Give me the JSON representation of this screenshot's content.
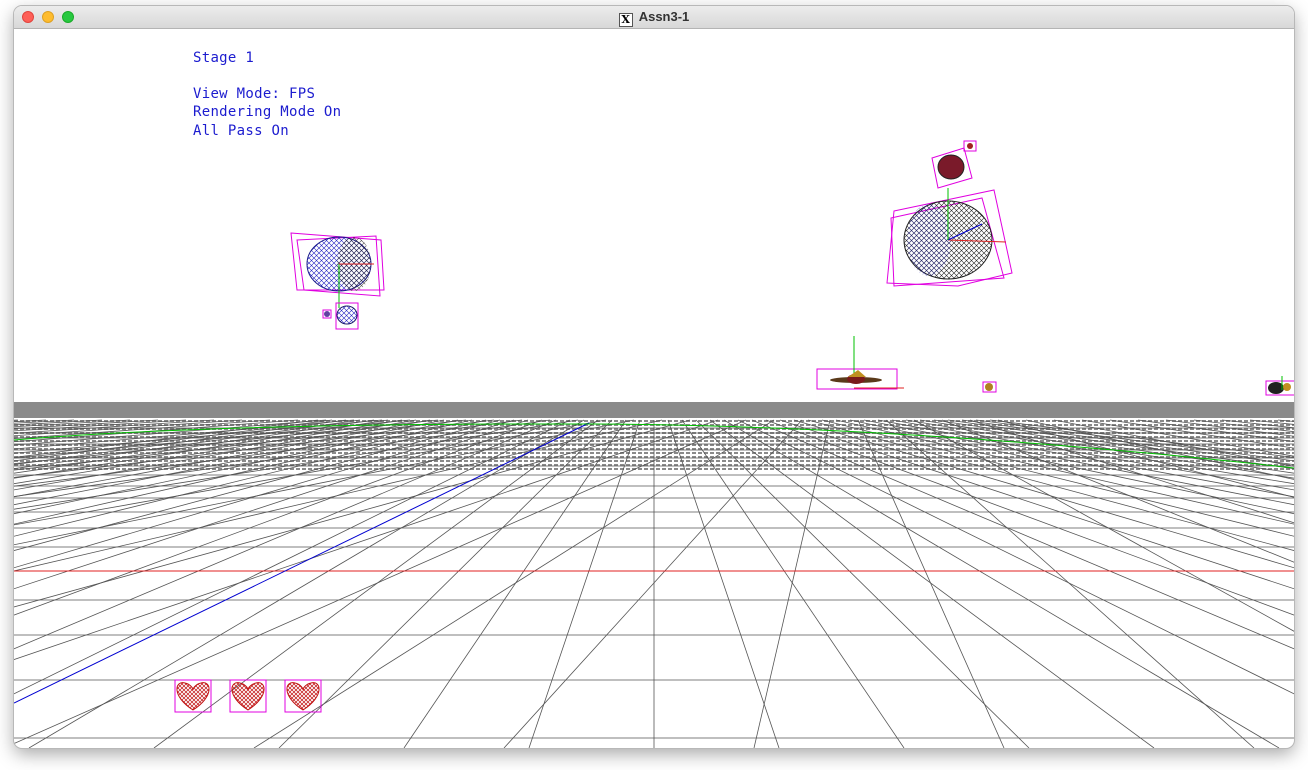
{
  "window": {
    "title": "Assn3-1",
    "x11_glyph": "X"
  },
  "hud": {
    "stage": "Stage 1",
    "view_mode": "View Mode: FPS",
    "rendering_mode": "Rendering Mode On",
    "all_pass": "All Pass On"
  },
  "lives": {
    "count": 3,
    "icon": "heart-icon"
  },
  "colors": {
    "hud_text": "#1c1ccf",
    "bounding_box": "#e000e0",
    "axis_x": "#e02020",
    "axis_y": "#00c000",
    "axis_z": "#0000d0",
    "grid": "#555555",
    "horizon": "#808080",
    "heart": "#c01010"
  }
}
